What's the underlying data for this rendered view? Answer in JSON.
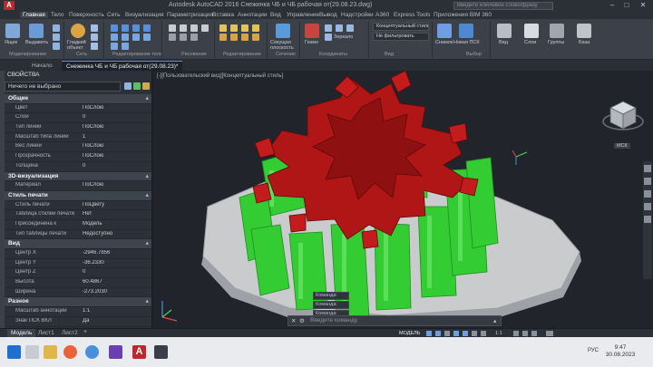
{
  "window": {
    "title": "Autodesk AutoCAD 2016   Снежинка ЧБ и ЧБ рабочая от(29.08.23.dwg)",
    "search_placeholder": "Введите ключевое слово/фразу"
  },
  "ribbon": {
    "tabs": [
      "Главная",
      "Тело",
      "Поверхность",
      "Сеть",
      "Визуализация",
      "Параметризация",
      "Вставка",
      "Аннотации",
      "Вид",
      "Управление",
      "Вывод",
      "Надстройки",
      "A360",
      "Express Tools",
      "Приложения BIM 360"
    ],
    "active_tab": "Главная",
    "buttons": {
      "view": "Ящик",
      "extrude": "Выдавить",
      "smooth": "Гладкий объект",
      "section_plane": "Секущая плоскость",
      "gizmo": "Гизмо",
      "snapshot": "Снимок",
      "layers": "Слои",
      "view_btn": "Вид",
      "groups": "Группы",
      "base": "База",
      "visual_style_drop": "Концептуальный стиль",
      "no_filter": "Не фильтровать",
      "mirror": "Зеркало",
      "new_view": "Новая ПСК"
    },
    "panels": [
      "Моделирование",
      "Сеть",
      "Редактирование тела",
      "Рисование",
      "Редактирование",
      "Сечение",
      "Координаты",
      "Вид",
      "Выбор"
    ]
  },
  "doc_tabs": [
    "Начало",
    "Снежинка ЧБ и ЧБ рабочая от(29.08.23)*"
  ],
  "active_doc_tab": 1,
  "properties": {
    "header": "СВОЙСТВА",
    "selection": "Ничего не выбрано",
    "rows": [
      {
        "type": "cat",
        "name": "Общие"
      },
      {
        "name": "Цвет",
        "value": "ПоСлою"
      },
      {
        "name": "Слой",
        "value": "0"
      },
      {
        "name": "Тип линий",
        "value": "ПоСлою"
      },
      {
        "name": "Масштаб типа линий",
        "value": "1"
      },
      {
        "name": "Вес линий",
        "value": "ПоСлою"
      },
      {
        "name": "Прозрачность",
        "value": "ПоСлою"
      },
      {
        "name": "Толщина",
        "value": "0"
      },
      {
        "type": "cat",
        "name": "3D-визуализация"
      },
      {
        "name": "Материал",
        "value": "ПоСлою"
      },
      {
        "type": "cat",
        "name": "Стиль печати"
      },
      {
        "name": "Стиль печати",
        "value": "ПоЦвету"
      },
      {
        "name": "Таблица стилей печати",
        "value": "Нет"
      },
      {
        "name": "Присоединена к",
        "value": "Модель"
      },
      {
        "name": "Тип таблицы печати",
        "value": "Недоступно"
      },
      {
        "type": "cat",
        "name": "Вид"
      },
      {
        "name": "Центр X",
        "value": "-2946.7856"
      },
      {
        "name": "Центр Y",
        "value": "-36.2330"
      },
      {
        "name": "Центр Z",
        "value": "0"
      },
      {
        "name": "Высота",
        "value": "60.4867"
      },
      {
        "name": "Ширина",
        "value": "-273.2030"
      },
      {
        "type": "cat",
        "name": "Разное"
      },
      {
        "name": "Масштаб аннотаций",
        "value": "1:1"
      },
      {
        "name": "Знак ПСК ВКЛ",
        "value": "Да"
      }
    ]
  },
  "viewport": {
    "label": "[-][Пользовательский вид][Концептуальный стиль]",
    "cube_label": "МСК"
  },
  "command": {
    "history": [
      "Команда:",
      "Команда:",
      "Команда:"
    ],
    "prompt": "Введите команду"
  },
  "layout_tabs": [
    "Модель",
    "Лист1",
    "Лист2"
  ],
  "status": {
    "model": "МОДЕЛЬ",
    "scale": "1:1"
  },
  "taskbar": {
    "lang": "РУС",
    "time": "9:47",
    "date": "30.08.2023"
  },
  "colors": {
    "gear_green": "#33cc33",
    "snowflake_red": "#b01616",
    "base_gray": "#c9cbcd",
    "autocad_red": "#c0272d"
  }
}
